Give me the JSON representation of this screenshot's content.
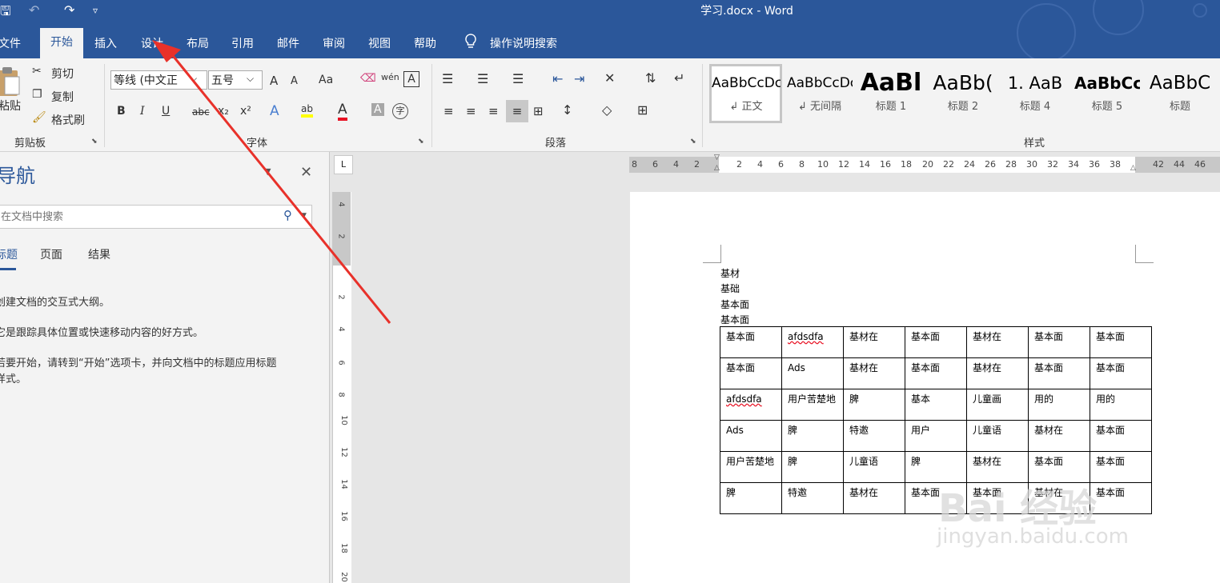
{
  "window": {
    "title": "学习.docx - Word",
    "quick_access": {
      "save": "🖫",
      "undo": "↶",
      "redo": "↷",
      "customize": "▿"
    }
  },
  "ribbon_tabs": {
    "file": "文件",
    "home": "开始",
    "insert": "插入",
    "design": "设计",
    "layout": "布局",
    "references": "引用",
    "mailings": "邮件",
    "review": "审阅",
    "view": "视图",
    "help": "帮助",
    "tell_me": "操作说明搜索"
  },
  "clipboard": {
    "paste": "粘贴",
    "cut": "剪切",
    "copy": "复制",
    "format_painter": "格式刷",
    "group_label": "剪贴板"
  },
  "font": {
    "font_name": "等线 (中文正",
    "font_size": "五号",
    "grow": "A",
    "shrink": "A",
    "change_case": "Aa",
    "phonetic": "wén",
    "char_border": "A",
    "bold": "B",
    "italic": "I",
    "underline": "U",
    "strike": "abc",
    "subscript": "x₂",
    "superscript": "x²",
    "text_effects": "A",
    "highlight": "ab",
    "font_color": "A",
    "char_shading": "A",
    "enclose": "字",
    "group_label": "字体"
  },
  "paragraph": {
    "group_label": "段落"
  },
  "styles": {
    "group_label": "样式",
    "items": [
      {
        "sample": "AaBbCcDc",
        "name": "↲ 正文"
      },
      {
        "sample": "AaBbCcDc",
        "name": "↲ 无间隔"
      },
      {
        "sample": "AaBl",
        "name": "标题 1"
      },
      {
        "sample": "AaBb(",
        "name": "标题 2"
      },
      {
        "sample": "1.  AaB",
        "name": "标题 4"
      },
      {
        "sample": "AaBbCc",
        "name": "标题 5"
      },
      {
        "sample": "AaBbC",
        "name": "标题"
      }
    ]
  },
  "navigation": {
    "title": "导航",
    "search_placeholder": "在文档中搜索",
    "tabs": [
      "标题",
      "页面",
      "结果"
    ],
    "text1": "创建文档的交互式大纲。",
    "text2": "它是跟踪具体位置或快速移动内容的好方式。",
    "text3a": "若要开始，请转到“开始”选项卡，并向文档中的标题应用标题",
    "text3b": "样式。"
  },
  "rulers": {
    "h_ticks": [
      "8",
      "6",
      "4",
      "2",
      "2",
      "4",
      "6",
      "8",
      "10",
      "12",
      "14",
      "16",
      "18",
      "20",
      "22",
      "24",
      "26",
      "28",
      "30",
      "32",
      "34",
      "36",
      "38",
      "42",
      "44",
      "46"
    ],
    "v_ticks": [
      "4",
      "2",
      "2",
      "4",
      "6",
      "8",
      "10",
      "12",
      "14",
      "16",
      "18",
      "20"
    ],
    "tab_selector": "L"
  },
  "document": {
    "lines": [
      "基材",
      "基础",
      "基本面",
      "基本面"
    ],
    "table": [
      [
        "基本面",
        "afdsdfa",
        "基材在",
        "基本面",
        "基材在",
        "基本面",
        "基本面"
      ],
      [
        "基本面",
        "Ads",
        "基材在",
        "基本面",
        "基材在",
        "基本面",
        "基本面"
      ],
      [
        "afdsdfa",
        "用户苦楚地",
        "脾",
        "基本",
        "儿童画",
        "用的",
        "用的"
      ],
      [
        "Ads",
        "脾",
        "特邀",
        "用户",
        "儿童语",
        "基材在",
        "基本面"
      ],
      [
        "用户苦楚地",
        "脾",
        "儿童语",
        "脾",
        "基材在",
        "基本面",
        "基本面"
      ],
      [
        "脾",
        "特邀",
        "基材在",
        "基本面",
        "基本面",
        "基材在",
        "基本面"
      ]
    ]
  },
  "watermark": {
    "brand": "Bai 经验",
    "url": "jingyan.baidu.com"
  },
  "colors": {
    "accent": "#2b579a",
    "arrow": "#e8312a"
  }
}
